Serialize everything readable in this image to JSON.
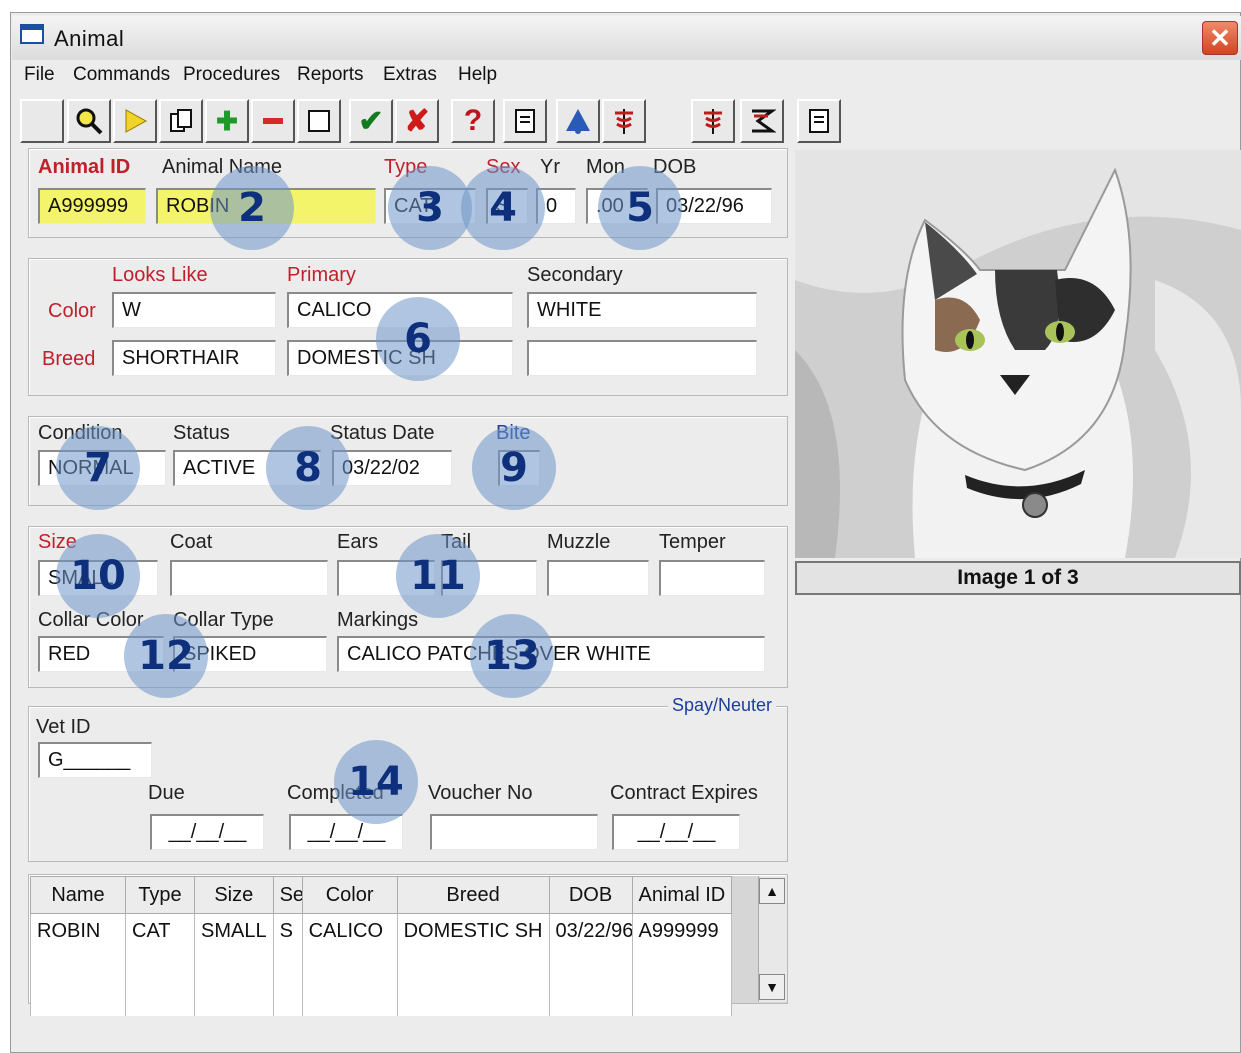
{
  "window": {
    "title": "Animal",
    "close": "✕"
  },
  "menu": [
    "File",
    "Commands",
    "Procedures",
    "Reports",
    "Extras",
    "Help"
  ],
  "toolbar_icons": [
    "blank",
    "search-icon",
    "next-arrow-icon",
    "copy-icon",
    "add-icon",
    "remove-icon",
    "clear-icon",
    "confirm-check-icon",
    "cancel-x-icon",
    "help-icon",
    "document-icon",
    "bell-icon",
    "medical-icon",
    "medical-icon",
    "cycle-icon",
    "report-icon"
  ],
  "ident": {
    "labels": {
      "animal_id": "Animal ID",
      "animal_name": "Animal Name",
      "type": "Type",
      "sex": "Sex",
      "yr": "Yr",
      "mon": "Mon",
      "dob": "DOB"
    },
    "values": {
      "animal_id": "A999999",
      "animal_name": "ROBIN",
      "type": "CAT",
      "sex": "S",
      "yr": "0",
      "mon": ".00",
      "dob": "03/22/96"
    }
  },
  "appearance": {
    "labels": {
      "looks_like": "Looks Like",
      "primary": "Primary",
      "secondary": "Secondary",
      "color": "Color",
      "breed": "Breed"
    },
    "color": {
      "looks_like": "W",
      "primary": "CALICO",
      "secondary": "WHITE"
    },
    "breed": {
      "looks_like": "SHORTHAIR",
      "primary": "DOMESTIC SH",
      "secondary": ""
    }
  },
  "status_panel": {
    "labels": {
      "condition": "Condition",
      "status": "Status",
      "status_date": "Status Date",
      "bite": "Bite"
    },
    "values": {
      "condition": "NORMAL",
      "status": "ACTIVE",
      "status_date": "03/22/02"
    }
  },
  "features": {
    "labels": {
      "size": "Size",
      "coat": "Coat",
      "ears": "Ears",
      "tail": "Tail",
      "muzzle": "Muzzle",
      "temper": "Temper",
      "collar_color": "Collar Color",
      "collar_type": "Collar Type",
      "markings": "Markings"
    },
    "values": {
      "size": "SMALL",
      "coat": "",
      "ears": "",
      "tail": "",
      "muzzle": "",
      "temper": "",
      "collar_color": "RED",
      "collar_type": "SPIKED",
      "markings": "CALICO PATCHES OVER WHITE"
    }
  },
  "spay": {
    "legend": "Spay/Neuter",
    "labels": {
      "vet_id": "Vet ID",
      "due": "Due",
      "completed": "Completed",
      "voucher": "Voucher No",
      "contract": "Contract Expires"
    },
    "values": {
      "vet_id": "G______",
      "due": "__/__/__",
      "completed": "__/__/__",
      "voucher": "",
      "contract": "__/__/__"
    }
  },
  "photo_caption": "Image 1 of 3",
  "grid": {
    "headers": [
      "Name",
      "Type",
      "Size",
      "Sex",
      "Color",
      "Breed",
      "DOB",
      "Animal ID"
    ],
    "rows": [
      [
        "ROBIN",
        "CAT",
        "SMALL",
        "S",
        "CALICO",
        "DOMESTIC SH",
        "03/22/96",
        "A999999"
      ],
      [
        "",
        "",
        "",
        "",
        "",
        "",
        "",
        ""
      ],
      [
        "",
        "",
        "",
        "",
        "",
        "",
        "",
        ""
      ]
    ]
  },
  "callouts": [
    "2",
    "3",
    "4",
    "5",
    "6",
    "7",
    "8",
    "9",
    "10",
    "11",
    "12",
    "13",
    "14"
  ]
}
